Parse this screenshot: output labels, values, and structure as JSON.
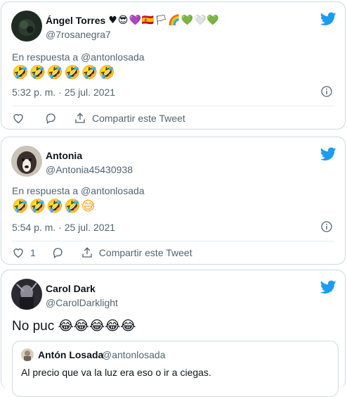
{
  "tweets": [
    {
      "name": "Ángel Torres",
      "name_emojis": "♥😎💜🇪🇸🏳🌈💚🤍💚",
      "handle": "@7rosanegra7",
      "reply_to": "En respuesta a @antonlosada",
      "emojis": "🤣🤣🤣🤣🤣🤣",
      "timestamp": "5:32 p. m. · 25 jul. 2021",
      "like_count": "",
      "share_label": "Compartir este Tweet"
    },
    {
      "name": "Antonia",
      "handle": "@Antonia45430938",
      "reply_to": "En respuesta a @antonlosada",
      "emojis": "🤣🤣🤣🤣😅",
      "timestamp": "5:54 p. m. · 25 jul. 2021",
      "like_count": "1",
      "share_label": "Compartir este Tweet"
    },
    {
      "name": "Carol Dark",
      "handle": "@CarolDarklight",
      "text": "No puc 😂😂😂😂😂",
      "quote": {
        "name": "Antón Losada",
        "handle": "@antonlosada",
        "text": "Al precio que va la luz era eso o ir a ciegas."
      }
    }
  ],
  "colors": {
    "twitter_blue": "#1d9bf0",
    "muted": "#536471",
    "border": "#cfd9de"
  }
}
